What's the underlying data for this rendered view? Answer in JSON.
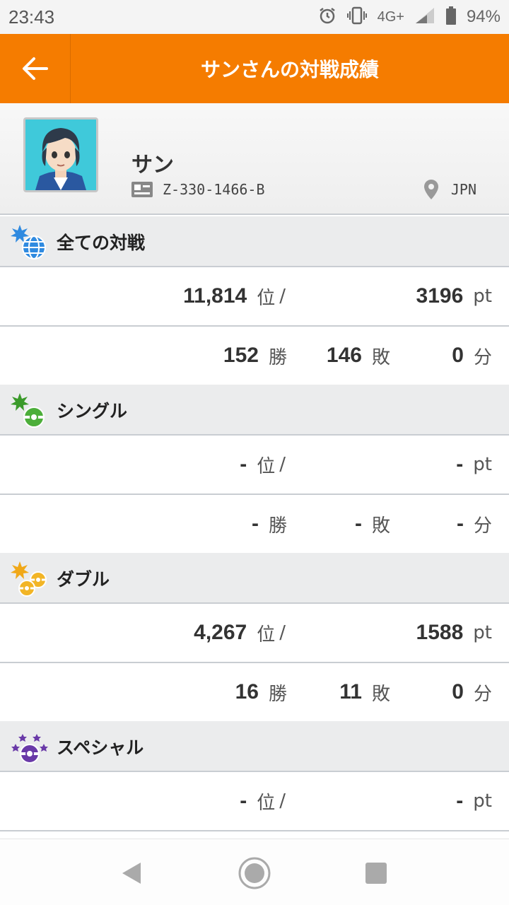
{
  "status_bar": {
    "time": "23:43",
    "network": "4G+",
    "battery": "94%"
  },
  "header": {
    "title": "サンさんの対戦成績"
  },
  "profile": {
    "name": "サン",
    "trainer_id": "Z-330-1466-B",
    "country": "JPN"
  },
  "units": {
    "rank": "位",
    "slash": "/",
    "pt": "pt",
    "win": "勝",
    "loss": "敗",
    "draw": "分"
  },
  "sections": [
    {
      "title": "全ての対戦",
      "icon": "globe-icon",
      "rank": "11,814",
      "points": "3196",
      "wins": "152",
      "losses": "146",
      "draws": "0"
    },
    {
      "title": "シングル",
      "icon": "single-battle-icon",
      "rank": "-",
      "points": "-",
      "wins": "-",
      "losses": "-",
      "draws": "-"
    },
    {
      "title": "ダブル",
      "icon": "double-battle-icon",
      "rank": "4,267",
      "points": "1588",
      "wins": "16",
      "losses": "11",
      "draws": "0"
    },
    {
      "title": "スペシャル",
      "icon": "special-battle-icon",
      "rank": "-",
      "points": "-"
    }
  ],
  "colors": {
    "accent": "#f57c00",
    "section_bg": "#ebeced",
    "divider": "#c9cdd2"
  }
}
